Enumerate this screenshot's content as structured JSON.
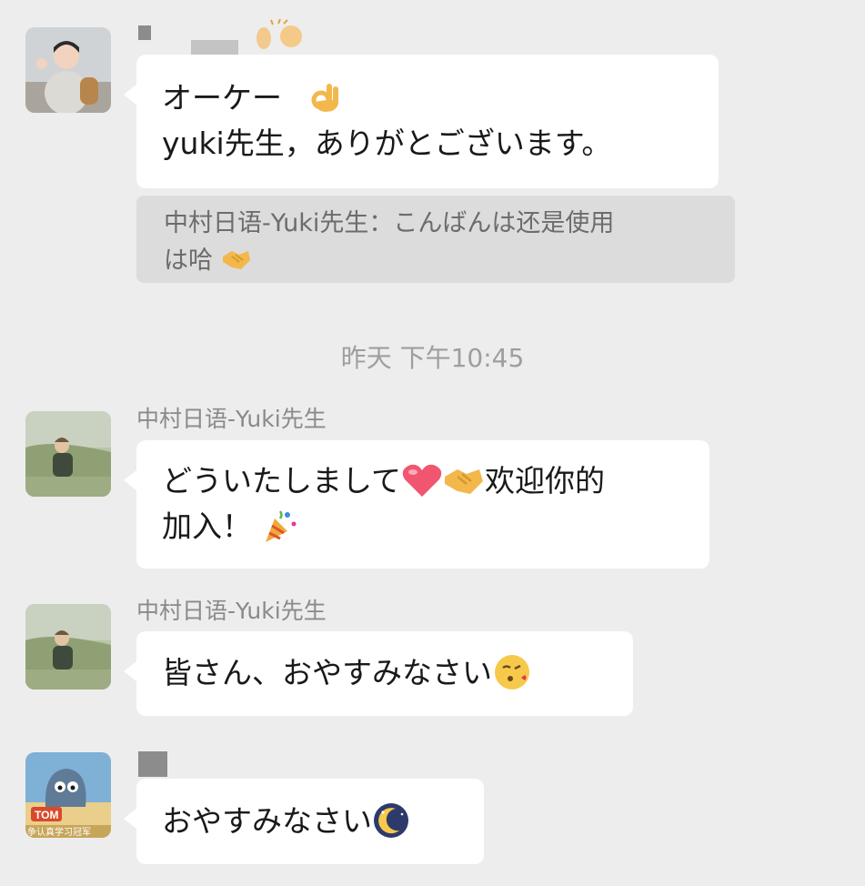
{
  "messages": [
    {
      "lines": [
        "オーケー",
        "yuki先生，ありがとございます。"
      ],
      "quote": {
        "line1": "中村日语-Yuki先生：こんばんは还是使用",
        "line2": "は哈"
      }
    },
    {
      "sender": "中村日语-Yuki先生",
      "lines": [
        "どういたしまして",
        "欢迎你的",
        "加入！"
      ]
    },
    {
      "sender": "中村日语-Yuki先生",
      "lines": [
        "皆さん、おやすみなさい"
      ]
    },
    {
      "lines": [
        "おやすみなさい"
      ]
    }
  ],
  "timestamp": "昨天 下午10:45",
  "emojis": [
    "clap-emoji",
    "ok-hand-emoji",
    "handshake-emoji",
    "heart-emoji",
    "party-popper-emoji",
    "kiss-emoji",
    "moon-emoji"
  ],
  "avatar_text": {
    "tom": "TOM",
    "caption": "争认真学习冠军"
  },
  "colors": {
    "background": "#ededed",
    "bubble": "#ffffff",
    "quote_bg": "#dcdcdc",
    "meta_text": "#8a8a8a"
  }
}
